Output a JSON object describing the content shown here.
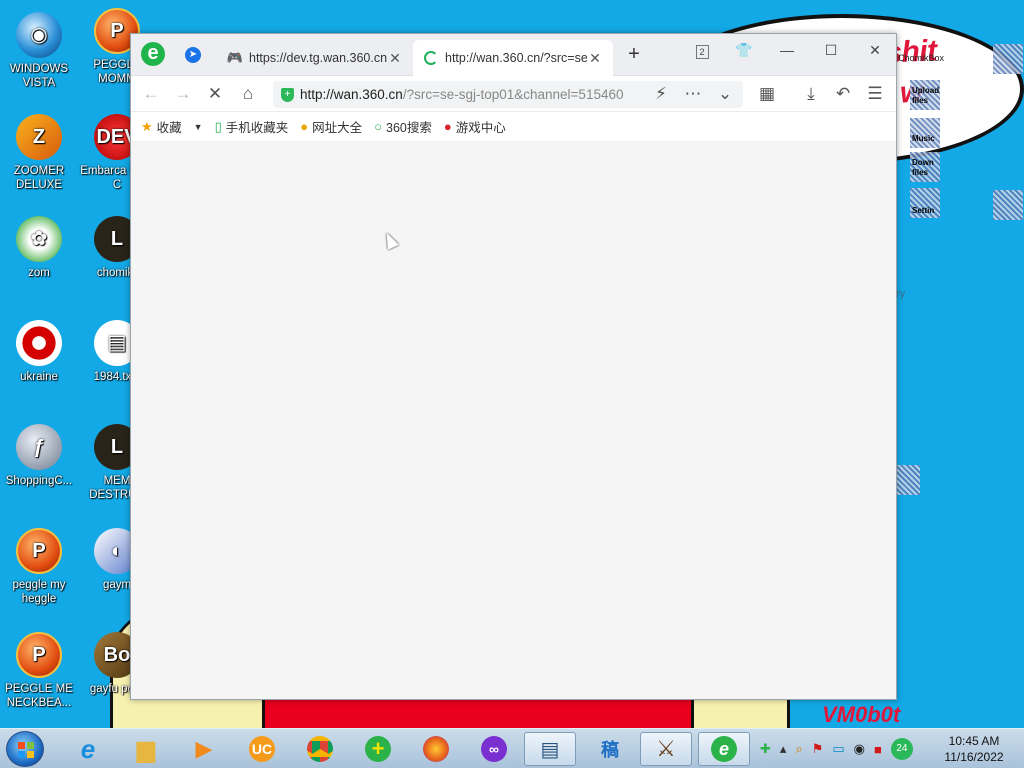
{
  "desktop": {
    "bubble_line1": "t shit",
    "bubble_line2": "w",
    "watermark": "VM0b0t",
    "side_labels": [
      "ChomikBox",
      "Upload files",
      "Music",
      "Down files",
      "Settin",
      "ry"
    ],
    "icons": [
      {
        "label": "WINDOWS VISTA",
        "icon": "windows-vista-icon"
      },
      {
        "label": "PEGGLE MOMM",
        "icon": "peggle-icon"
      },
      {
        "label": "ZOOMER DELUXE",
        "icon": "zoomer-icon"
      },
      {
        "label": "Embarca Dev-C",
        "icon": "devcpp-icon"
      },
      {
        "label": "zom",
        "icon": "flower-icon"
      },
      {
        "label": "chomikr",
        "icon": "clock-icon"
      },
      {
        "label": "ukraine",
        "icon": "radiation-icon"
      },
      {
        "label": "1984.txt.l",
        "icon": "text-file-icon"
      },
      {
        "label": "ShoppingC...",
        "icon": "flash-icon"
      },
      {
        "label": "MEM DESTRUC",
        "icon": "clock-icon"
      },
      {
        "label": "peggle my heggle",
        "icon": "peggle-icon"
      },
      {
        "label": "gaym",
        "icon": "media-icon"
      },
      {
        "label": "PEGGLE ME NECKBEA...",
        "icon": "peggle-icon"
      },
      {
        "label": "gayfu porn",
        "icon": "dog-icon"
      }
    ]
  },
  "browser": {
    "tabs": [
      {
        "title": "https://dev.tg.wan.360.cn",
        "icon": "gamepad-icon",
        "active": false
      },
      {
        "title": "http://wan.360.cn/?src=se",
        "icon": "loading-spinner-icon",
        "active": true
      }
    ],
    "new_tab": "+",
    "window_badge": "2",
    "address": {
      "host": "http://wan.360.cn",
      "path": "/?src=se-sgj-top01&channel=515460"
    },
    "bookmarks": [
      {
        "label": "收藏",
        "icon": "star-icon"
      },
      {
        "label": "手机收藏夹",
        "icon": "phone-icon"
      },
      {
        "label": "网址大全",
        "icon": "globe-icon"
      },
      {
        "label": "360搜索",
        "icon": "search360-icon"
      },
      {
        "label": "游戏中心",
        "icon": "game-center-icon"
      }
    ]
  },
  "taskbar": {
    "time": "10:45 AM",
    "date": "11/16/2022",
    "tray_badge": "24"
  }
}
